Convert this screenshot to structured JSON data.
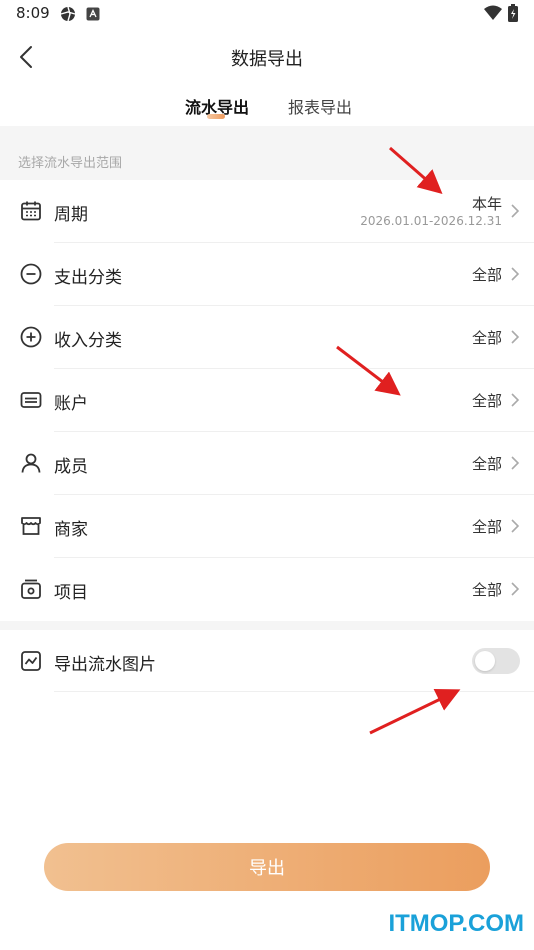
{
  "status_bar": {
    "time": "8:09"
  },
  "header": {
    "title": "数据导出"
  },
  "tabs": [
    {
      "label": "流水导出",
      "active": true
    },
    {
      "label": "报表导出",
      "active": false
    }
  ],
  "section_title": "选择流水导出范围",
  "rows": [
    {
      "icon": "calendar-icon",
      "label": "周期",
      "value": "本年",
      "subvalue": "2026.01.01-2026.12.31"
    },
    {
      "icon": "minus-circle-icon",
      "label": "支出分类",
      "value": "全部"
    },
    {
      "icon": "plus-circle-icon",
      "label": "收入分类",
      "value": "全部"
    },
    {
      "icon": "card-icon",
      "label": "账户",
      "value": "全部"
    },
    {
      "icon": "person-icon",
      "label": "成员",
      "value": "全部"
    },
    {
      "icon": "store-icon",
      "label": "商家",
      "value": "全部"
    },
    {
      "icon": "project-icon",
      "label": "项目",
      "value": "全部"
    }
  ],
  "toggle": {
    "icon": "image-chart-icon",
    "label": "导出流水图片",
    "on": false
  },
  "export_button": "导出",
  "watermark": "ITMOP.COM",
  "colors": {
    "accent": "#ee9a5c",
    "arrow": "#e02020",
    "watermark": "#1aa1d9"
  }
}
